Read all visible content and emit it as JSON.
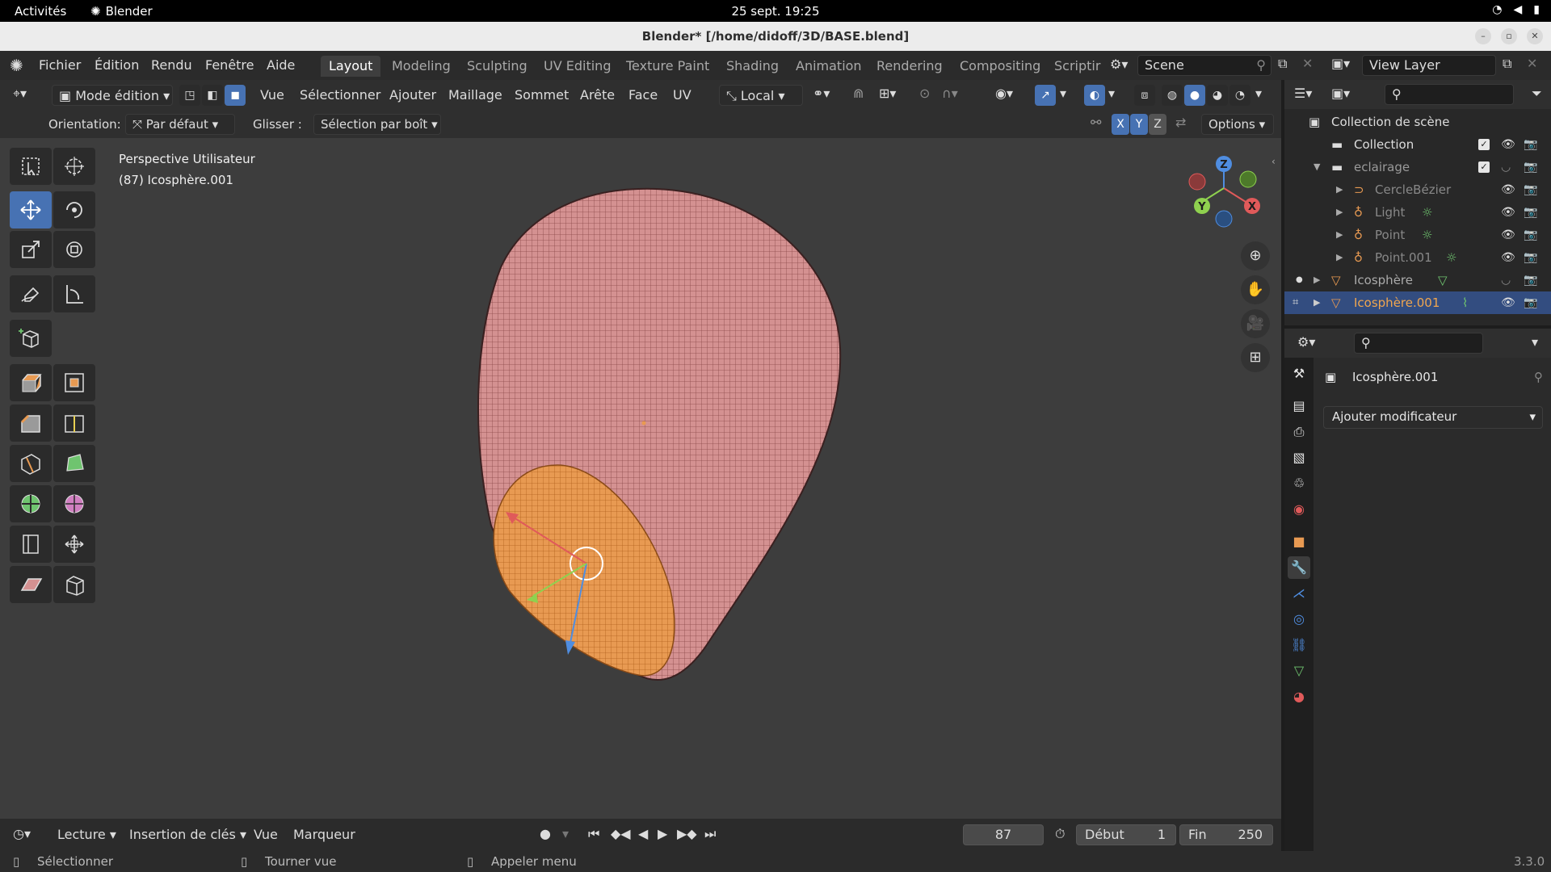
{
  "gnome": {
    "activities": "Activités",
    "app_name": "Blender",
    "clock": "25 sept.  19:25"
  },
  "window": {
    "title": "Blender* [/home/didoff/3D/BASE.blend]"
  },
  "topbar": {
    "menus": [
      "Fichier",
      "Édition",
      "Rendu",
      "Fenêtre",
      "Aide"
    ],
    "workspaces": [
      "Layout",
      "Modeling",
      "Sculpting",
      "UV Editing",
      "Texture Paint",
      "Shading",
      "Animation",
      "Rendering",
      "Compositing",
      "Scriptir"
    ],
    "active_workspace": "Layout",
    "scene": "Scene",
    "view_layer": "View Layer"
  },
  "viewport_header": {
    "mode": "Mode édition",
    "menus": [
      "Vue",
      "Sélectionner",
      "Ajouter",
      "Maillage",
      "Sommet",
      "Arête",
      "Face",
      "UV"
    ],
    "transform_orientation": "Local",
    "orientation_label": "Orientation:",
    "orientation_value": "Par défaut",
    "drag_label": "Glisser :",
    "drag_value": "Sélection par boît",
    "axes": [
      "X",
      "Y",
      "Z"
    ],
    "options": "Options"
  },
  "viewport": {
    "view_name": "Perspective Utilisateur",
    "object_info": "(87) Icosphère.001",
    "mesh_color": "#d49191",
    "selected_face_color": "#e89a52",
    "background": "#3d3d3d"
  },
  "gizmo": {
    "x": "X",
    "y": "Y",
    "z": "Z"
  },
  "timeline": {
    "playback": "Lecture",
    "keying": "Insertion de clés",
    "view": "Vue",
    "markers": "Marqueur",
    "current_frame": "87",
    "start_label": "Début",
    "start": "1",
    "end_label": "Fin",
    "end": "250"
  },
  "status": {
    "select": "Sélectionner",
    "rotate": "Tourner vue",
    "menu": "Appeler menu",
    "version": "3.3.0"
  },
  "outliner": {
    "root": "Collection de scène",
    "items": [
      {
        "name": "Collection",
        "icon": "collection-icon"
      },
      {
        "name": "eclairage",
        "icon": "collection-icon"
      },
      {
        "name": "CercleBézier",
        "icon": "curve-icon"
      },
      {
        "name": "Light",
        "icon": "light-icon"
      },
      {
        "name": "Point",
        "icon": "light-icon"
      },
      {
        "name": "Point.001",
        "icon": "light-icon"
      },
      {
        "name": "Icosphère",
        "icon": "mesh-icon"
      },
      {
        "name": "Icosphère.001",
        "icon": "mesh-icon"
      }
    ]
  },
  "properties": {
    "object_name": "Icosphère.001",
    "add_modifier": "Ajouter modificateur"
  }
}
